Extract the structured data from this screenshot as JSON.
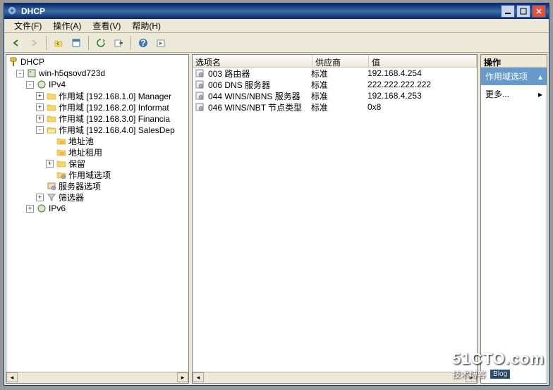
{
  "title": "DHCP",
  "menubar": {
    "file": "文件(F)",
    "action": "操作(A)",
    "view": "查看(V)",
    "help": "帮助(H)"
  },
  "tree": {
    "root": "DHCP",
    "server": "win-h5qsovd723d",
    "ipv4": "IPv4",
    "scopes": [
      "作用域 [192.168.1.0] Manager",
      "作用域 [192.168.2.0] Informat",
      "作用域 [192.168.3.0] Financia",
      "作用域 [192.168.4.0] SalesDep"
    ],
    "children": {
      "pool": "地址池",
      "leases": "地址租用",
      "reservations": "保留",
      "scopeopts": "作用域选项"
    },
    "serveropts": "服务器选项",
    "filters": "筛选器",
    "ipv6": "IPv6"
  },
  "list": {
    "headers": {
      "name": "选项名",
      "vendor": "供应商",
      "value": "值"
    },
    "rows": [
      {
        "name": "003 路由器",
        "vendor": "标准",
        "value": "192.168.4.254"
      },
      {
        "name": "006 DNS 服务器",
        "vendor": "标准",
        "value": "222.222.222.222"
      },
      {
        "name": "044 WINS/NBNS 服务器",
        "vendor": "标准",
        "value": "192.168.4.253"
      },
      {
        "name": "046 WINS/NBT 节点类型",
        "vendor": "标准",
        "value": "0x8"
      }
    ]
  },
  "actions": {
    "header": "操作",
    "context": "作用域选项",
    "more": "更多..."
  },
  "watermark": {
    "site": "51CTO.com",
    "sub": "技术博客",
    "badge": "Blog"
  }
}
